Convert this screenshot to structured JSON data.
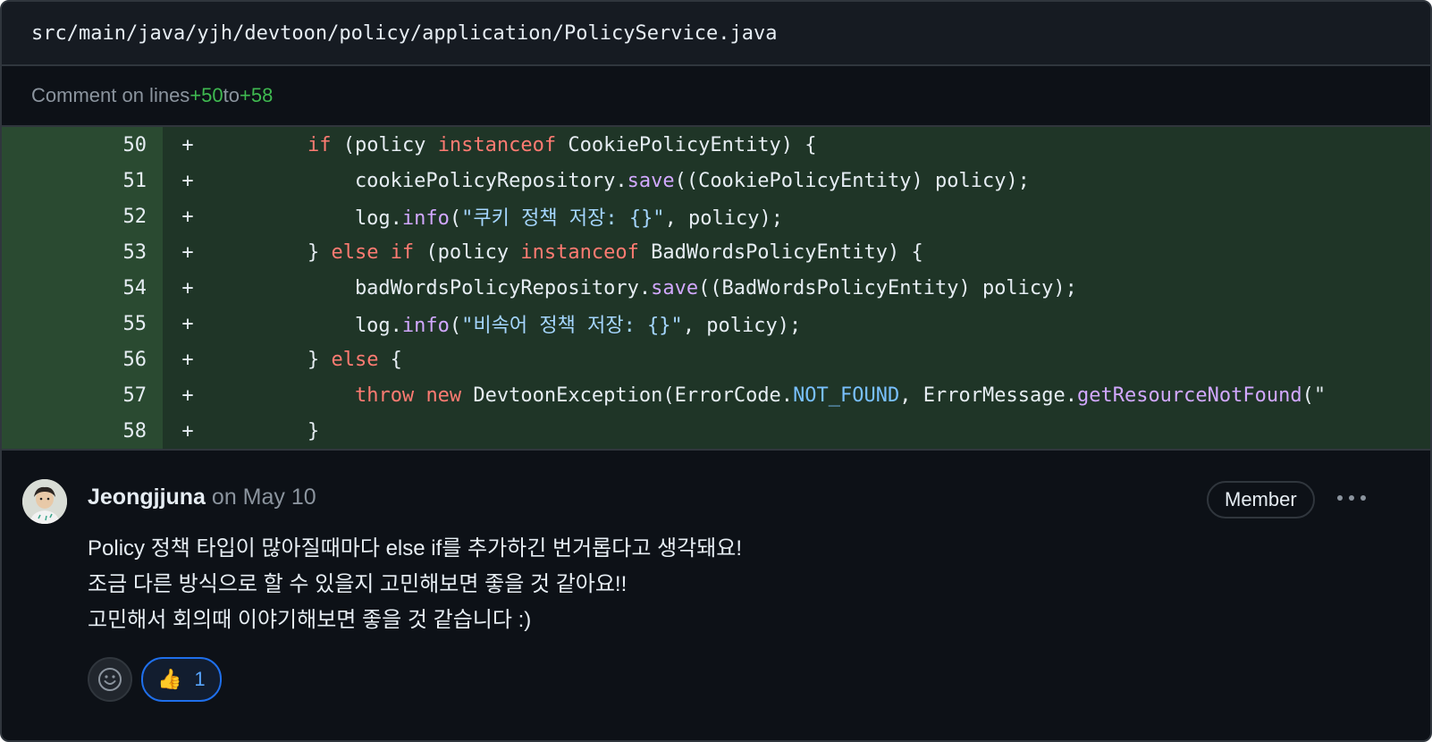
{
  "file": {
    "path": "src/main/java/yjh/devtoon/policy/application/PolicyService.java"
  },
  "comment_range": {
    "prefix": "Comment on lines ",
    "start": "+50",
    "middle": " to ",
    "end": "+58"
  },
  "diff": {
    "lines": [
      {
        "num": "50",
        "sign": "+",
        "tokens": [
          {
            "t": "        "
          },
          {
            "t": "if",
            "c": "kw"
          },
          {
            "t": " (policy "
          },
          {
            "t": "instanceof",
            "c": "kw"
          },
          {
            "t": " CookiePolicyEntity) {"
          }
        ]
      },
      {
        "num": "51",
        "sign": "+",
        "tokens": [
          {
            "t": "            cookiePolicyRepository."
          },
          {
            "t": "save",
            "c": "fn"
          },
          {
            "t": "((CookiePolicyEntity) policy);"
          }
        ]
      },
      {
        "num": "52",
        "sign": "+",
        "tokens": [
          {
            "t": "            log."
          },
          {
            "t": "info",
            "c": "fn"
          },
          {
            "t": "("
          },
          {
            "t": "\"쿠키 정책 저장: {}\"",
            "c": "str"
          },
          {
            "t": ", policy);"
          }
        ]
      },
      {
        "num": "53",
        "sign": "+",
        "tokens": [
          {
            "t": "        } "
          },
          {
            "t": "else",
            "c": "kw"
          },
          {
            "t": " "
          },
          {
            "t": "if",
            "c": "kw"
          },
          {
            "t": " (policy "
          },
          {
            "t": "instanceof",
            "c": "kw"
          },
          {
            "t": " BadWordsPolicyEntity) {"
          }
        ]
      },
      {
        "num": "54",
        "sign": "+",
        "tokens": [
          {
            "t": "            badWordsPolicyRepository."
          },
          {
            "t": "save",
            "c": "fn"
          },
          {
            "t": "((BadWordsPolicyEntity) policy);"
          }
        ]
      },
      {
        "num": "55",
        "sign": "+",
        "tokens": [
          {
            "t": "            log."
          },
          {
            "t": "info",
            "c": "fn"
          },
          {
            "t": "("
          },
          {
            "t": "\"비속어 정책 저장: {}\"",
            "c": "str"
          },
          {
            "t": ", policy);"
          }
        ]
      },
      {
        "num": "56",
        "sign": "+",
        "tokens": [
          {
            "t": "        } "
          },
          {
            "t": "else",
            "c": "kw"
          },
          {
            "t": " {"
          }
        ]
      },
      {
        "num": "57",
        "sign": "+",
        "tokens": [
          {
            "t": "            "
          },
          {
            "t": "throw",
            "c": "kw"
          },
          {
            "t": " "
          },
          {
            "t": "new",
            "c": "kw"
          },
          {
            "t": " DevtoonException(ErrorCode."
          },
          {
            "t": "NOT_FOUND",
            "c": "const"
          },
          {
            "t": ", ErrorMessage."
          },
          {
            "t": "getResourceNotFound",
            "c": "fn"
          },
          {
            "t": "(\""
          }
        ]
      },
      {
        "num": "58",
        "sign": "+",
        "tokens": [
          {
            "t": "        }"
          }
        ]
      }
    ]
  },
  "comment": {
    "author": "Jeongjjuna",
    "date": "on May 10",
    "badge": "Member",
    "more_icon": "kebab-horizontal-icon",
    "body": [
      "Policy 정책 타입이 많아질때마다 else if를 추가하긴 번거롭다고 생각돼요!",
      "조금 다른 방식으로 할 수 있을지 고민해보면 좋을 것 같아요!!",
      "고민해서 회의때 이야기해보면 좋을 것 같습니다 :)"
    ],
    "reactions": [
      {
        "emoji": "👍",
        "count": "1"
      }
    ]
  },
  "colors": {
    "bg": "#0d1117",
    "header_bg": "#161b22",
    "border": "#30363d",
    "diff_add_bg": "#1f3527",
    "diff_add_num_bg": "#2a4a31",
    "accent_green": "#3fb950",
    "keyword": "#ff7b72",
    "function": "#d2a8ff",
    "string": "#a5d6ff",
    "reaction_border": "#1f6feb"
  }
}
